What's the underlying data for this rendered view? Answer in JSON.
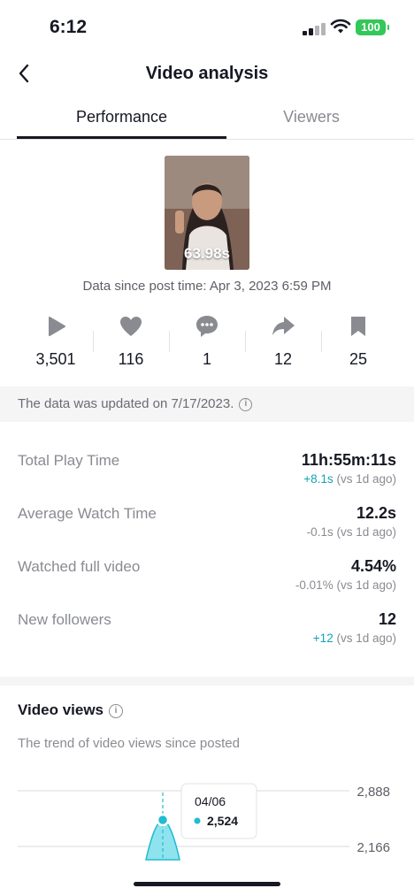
{
  "status_bar": {
    "time": "6:12",
    "battery": "100"
  },
  "header": {
    "title": "Video analysis"
  },
  "tabs": [
    {
      "label": "Performance",
      "active": true
    },
    {
      "label": "Viewers",
      "active": false
    }
  ],
  "video": {
    "duration": "63.98s",
    "data_since": "Data since post time: Apr 3, 2023 6:59 PM"
  },
  "stats": [
    {
      "icon": "play-icon",
      "value": "3,501"
    },
    {
      "icon": "heart-icon",
      "value": "116"
    },
    {
      "icon": "comment-icon",
      "value": "1"
    },
    {
      "icon": "share-icon",
      "value": "12"
    },
    {
      "icon": "bookmark-icon",
      "value": "25"
    }
  ],
  "banner": {
    "text": "The data was updated on 7/17/2023."
  },
  "metrics": [
    {
      "label": "Total Play Time",
      "value": "11h:55m:11s",
      "change": "+8.1s",
      "change_suffix": " (vs 1d ago)",
      "positive": true
    },
    {
      "label": "Average Watch Time",
      "value": "12.2s",
      "change": "-0.1s",
      "change_suffix": " (vs 1d ago)",
      "positive": false
    },
    {
      "label": "Watched full video",
      "value": "4.54%",
      "change": "-0.01%",
      "change_suffix": " (vs 1d ago)",
      "positive": false
    },
    {
      "label": "New followers",
      "value": "12",
      "change": "+12",
      "change_suffix": " (vs 1d ago)",
      "positive": true
    }
  ],
  "video_views": {
    "title": "Video views",
    "subtitle": "The trend of video views since posted"
  },
  "chart_data": {
    "type": "area",
    "x": [
      "04/06"
    ],
    "values": [
      2524
    ],
    "y_ticks": [
      "2,888",
      "2,166"
    ],
    "tooltip": {
      "date": "04/06",
      "value": "2,524"
    },
    "accent": "#20bcd0"
  },
  "colors": {
    "accent": "#13a3b5",
    "text": "#161823",
    "muted": "#8a8b91"
  }
}
